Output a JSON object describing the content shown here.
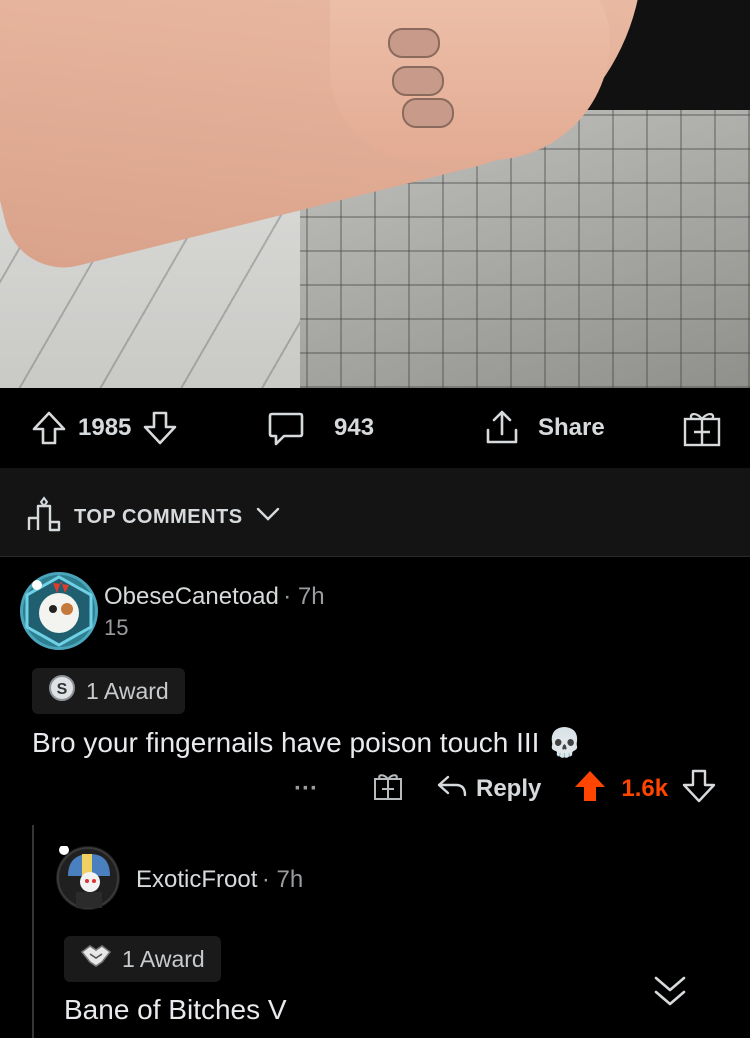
{
  "post": {
    "upvotes": "1985",
    "comments": "943",
    "share_label": "Share"
  },
  "sort": {
    "label": "TOP COMMENTS"
  },
  "comments": [
    {
      "author": "ObeseCanetoad",
      "age": "7h",
      "flair": "15",
      "award": "1 Award",
      "text": "Bro your fingernails have poison touch III",
      "emoji": "💀",
      "reply_label": "Reply",
      "score": "1.6k",
      "more": "···"
    },
    {
      "author": "ExoticFroot",
      "age": "7h",
      "award": "1 Award",
      "text": "Bane of Bitches V"
    }
  ],
  "colors": {
    "background": "#000000",
    "upvote_accent": "#ff4500",
    "muted": "#9a9da0"
  }
}
